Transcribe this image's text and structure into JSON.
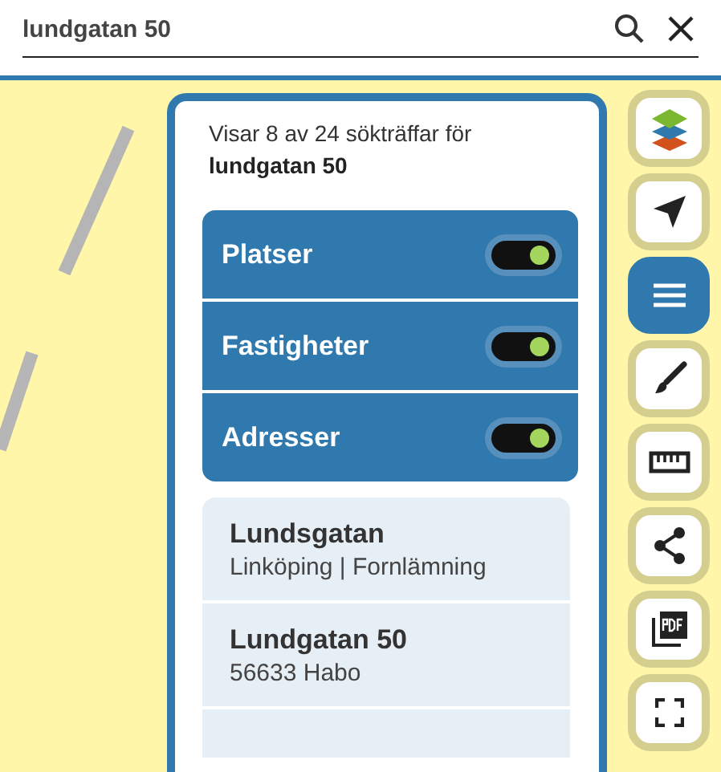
{
  "search": {
    "value": "lundgatan 50"
  },
  "results_panel": {
    "summary": "Visar 8 av 24 sökträffar för",
    "query": "lundgatan 50",
    "categories": [
      {
        "label": "Platser",
        "on": true
      },
      {
        "label": "Fastigheter",
        "on": true
      },
      {
        "label": "Adresser",
        "on": true
      }
    ],
    "results": [
      {
        "title": "Lundsgatan",
        "subtitle": "Linköping | Fornlämning"
      },
      {
        "title": "Lundgatan 50",
        "subtitle": "56633 Habo"
      }
    ],
    "more_results_cut_off": true
  },
  "toolbar": [
    {
      "kind": "layers",
      "selected": false
    },
    {
      "kind": "locate",
      "selected": false
    },
    {
      "kind": "menu",
      "selected": true
    },
    {
      "kind": "draw",
      "selected": false
    },
    {
      "kind": "measure",
      "selected": false
    },
    {
      "kind": "share",
      "selected": false
    },
    {
      "kind": "pdf",
      "selected": false
    },
    {
      "kind": "fullscreen",
      "selected": false
    }
  ]
}
